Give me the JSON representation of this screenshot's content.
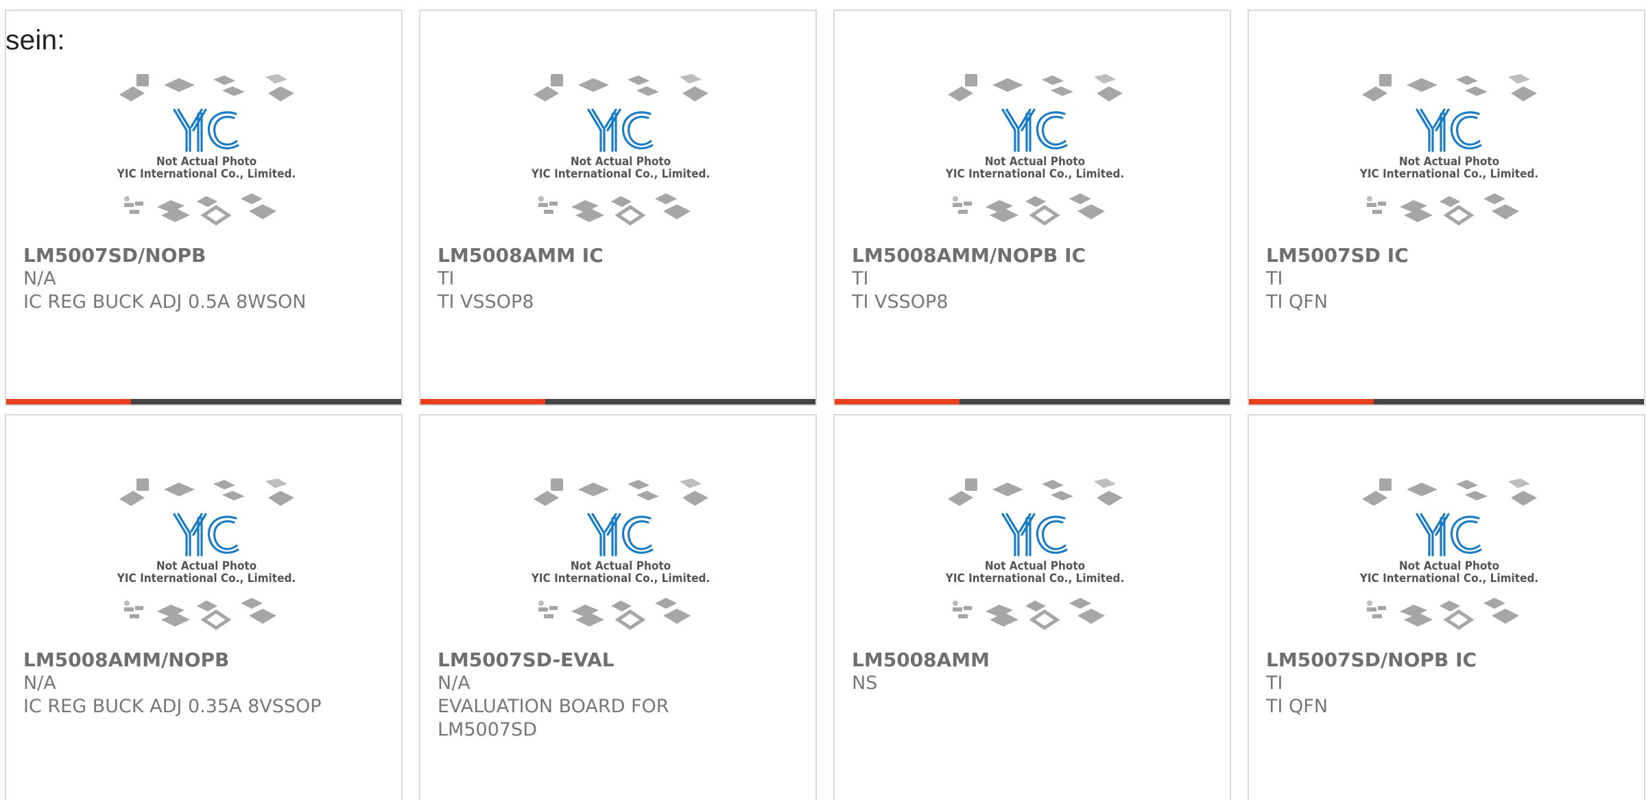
{
  "page": {
    "intro_text": "sein:"
  },
  "colors": {
    "accent": "#e8401c",
    "bar_dark": "#444444",
    "logo_blue": "#1a7cc4",
    "chip_gray": "#9a9a9a"
  },
  "placeholder": {
    "caption_line1": "Not Actual Photo",
    "caption_line2": "YIC International Co., Limited.",
    "logo_text": "YIC"
  },
  "products": [
    {
      "part_number": "LM5007SD/NOPB",
      "manufacturer": "N/A",
      "description": "IC REG BUCK ADJ 0.5A 8WSON",
      "description2": ""
    },
    {
      "part_number": "LM5008AMM IC",
      "manufacturer": "TI",
      "description": "TI VSSOP8",
      "description2": ""
    },
    {
      "part_number": "LM5008AMM/NOPB IC",
      "manufacturer": "TI",
      "description": "TI VSSOP8",
      "description2": ""
    },
    {
      "part_number": "LM5007SD IC",
      "manufacturer": "TI",
      "description": "TI QFN",
      "description2": ""
    },
    {
      "part_number": "LM5008AMM/NOPB",
      "manufacturer": "N/A",
      "description": "IC REG BUCK ADJ 0.35A 8VSSOP",
      "description2": ""
    },
    {
      "part_number": "LM5007SD-EVAL",
      "manufacturer": "N/A",
      "description": "EVALUATION BOARD FOR",
      "description2": "LM5007SD"
    },
    {
      "part_number": "LM5008AMM",
      "manufacturer": "NS",
      "description": "",
      "description2": ""
    },
    {
      "part_number": "LM5007SD/NOPB IC",
      "manufacturer": "TI",
      "description": "TI QFN",
      "description2": ""
    }
  ]
}
